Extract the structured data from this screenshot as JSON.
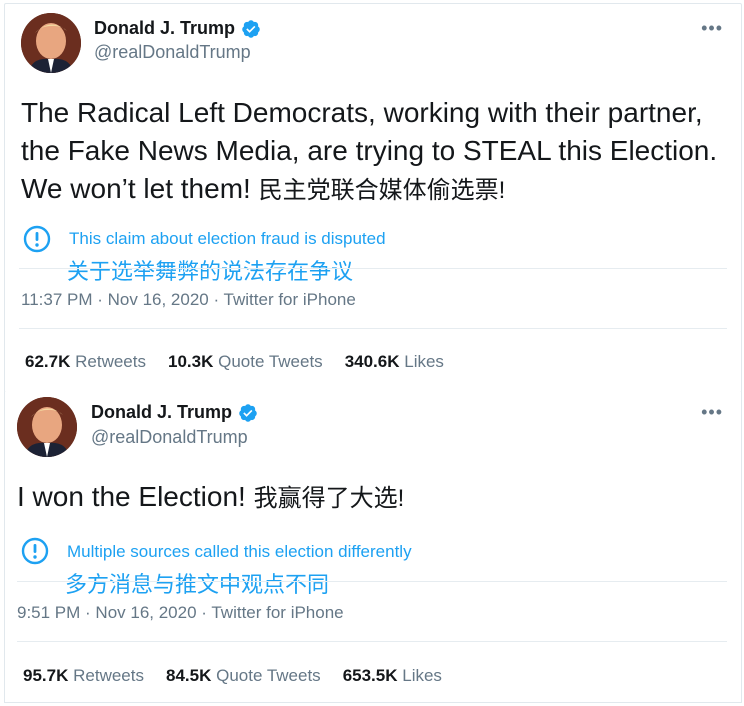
{
  "tweets": [
    {
      "name": "Donald J. Trump",
      "handle": "@realDonaldTrump",
      "text": "The Radical Left Democrats, working with their partner,\nthe Fake News Media, are trying to STEAL this Election.\nWe won’t let them! ",
      "text_cjk": "民主党联合媒体偷选票!",
      "notice": "This claim about election fraud is disputed",
      "notice_cjk": "关于选举舞弊的说法存在争议",
      "meta": "11:37 PM · Nov 16, 2020 · Twitter for iPhone",
      "retweets_count": "62.7K",
      "retweets_label": "Retweets",
      "quotes_count": "10.3K",
      "quotes_label": "Quote Tweets",
      "likes_count": "340.6K",
      "likes_label": "Likes"
    },
    {
      "name": "Donald J. Trump",
      "handle": "@realDonaldTrump",
      "text": "I won the Election! ",
      "text_cjk": "我赢得了大选!",
      "notice": "Multiple sources called this election differently",
      "notice_cjk": "多方消息与推文中观点不同",
      "meta": "9:51 PM · Nov 16, 2020 · Twitter for iPhone",
      "retweets_count": "95.7K",
      "retweets_label": "Retweets",
      "quotes_count": "84.5K",
      "quotes_label": "Quote Tweets",
      "likes_count": "653.5K",
      "likes_label": "Likes"
    }
  ],
  "colors": {
    "accent": "#1da1f2",
    "text": "#14171a",
    "secondary": "#657786",
    "border": "#e1e8ed"
  },
  "icons": {
    "verified": "verified-badge-icon",
    "more": "more-options-icon",
    "notice": "exclamation-circle-icon"
  }
}
